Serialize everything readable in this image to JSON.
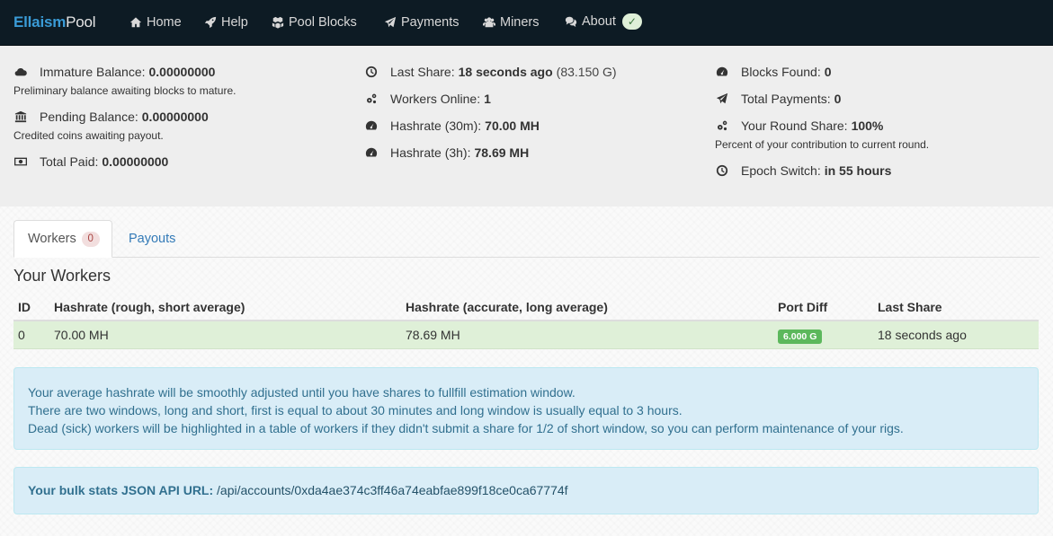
{
  "navbar": {
    "brand_part1": "Ellaism",
    "brand_part2": "Pool",
    "items": [
      {
        "label": "Home",
        "icon": "home-icon"
      },
      {
        "label": "Help",
        "icon": "rocket-icon"
      },
      {
        "label": "Pool Blocks",
        "icon": "cubes-icon"
      },
      {
        "label": "Payments",
        "icon": "paper-plane-icon"
      },
      {
        "label": "Miners",
        "icon": "users-icon"
      },
      {
        "label": "About",
        "icon": "comments-icon"
      }
    ],
    "about_badge": "✓"
  },
  "stats": {
    "immature_label": "Immature Balance:",
    "immature_value": "0.00000000",
    "immature_note": "Preliminary balance awaiting blocks to mature.",
    "pending_label": "Pending Balance:",
    "pending_value": "0.00000000",
    "pending_note": "Credited coins awaiting payout.",
    "paid_label": "Total Paid:",
    "paid_value": "0.00000000",
    "last_share_label": "Last Share:",
    "last_share_value": "18 seconds ago",
    "last_share_extra": "(83.150 G)",
    "workers_online_label": "Workers Online:",
    "workers_online_value": "1",
    "hashrate_30m_label": "Hashrate (30m):",
    "hashrate_30m_value": "70.00 MH",
    "hashrate_3h_label": "Hashrate (3h):",
    "hashrate_3h_value": "78.69 MH",
    "blocks_found_label": "Blocks Found:",
    "blocks_found_value": "0",
    "total_payments_label": "Total Payments:",
    "total_payments_value": "0",
    "round_share_label": "Your Round Share:",
    "round_share_value": "100%",
    "round_share_note": "Percent of your contribution to current round.",
    "epoch_label": "Epoch Switch:",
    "epoch_value": "in 55 hours"
  },
  "tabs": {
    "workers_label": "Workers",
    "workers_count": "0",
    "payouts_label": "Payouts"
  },
  "workers": {
    "title": "Your Workers",
    "headers": [
      "ID",
      "Hashrate (rough, short average)",
      "Hashrate (accurate, long average)",
      "Port Diff",
      "Last Share"
    ],
    "rows": [
      {
        "id": "0",
        "hr_short": "70.00 MH",
        "hr_long": "78.69 MH",
        "port_diff": "6.000 G",
        "last_share": "18 seconds ago"
      }
    ]
  },
  "info": {
    "line1": "Your average hashrate will be smoothly adjusted until you have shares to fullfill estimation window.",
    "line2": "There are two windows, long and short, first is equal to about 30 minutes and long window is usually equal to 3 hours.",
    "line3": "Dead (sick) workers will be highlighted in a table of workers if they didn't submit a share for 1/2 of short window, so you can perform maintenance of your rigs.",
    "api_label": "Your bulk stats JSON API URL:",
    "api_url": "/api/accounts/0xda4ae374c3ff46a74eabfae899f18ce0ca67774f"
  },
  "colors": {
    "navbar_bg": "#0d1b24",
    "brand_accent": "#3a9bd6",
    "stats_bg": "#eeeeee",
    "row_success": "#dff0d8",
    "label_success": "#5cb85c",
    "alert_info_bg": "#d9edf7",
    "alert_info_text": "#31708f",
    "link": "#337ab7"
  }
}
